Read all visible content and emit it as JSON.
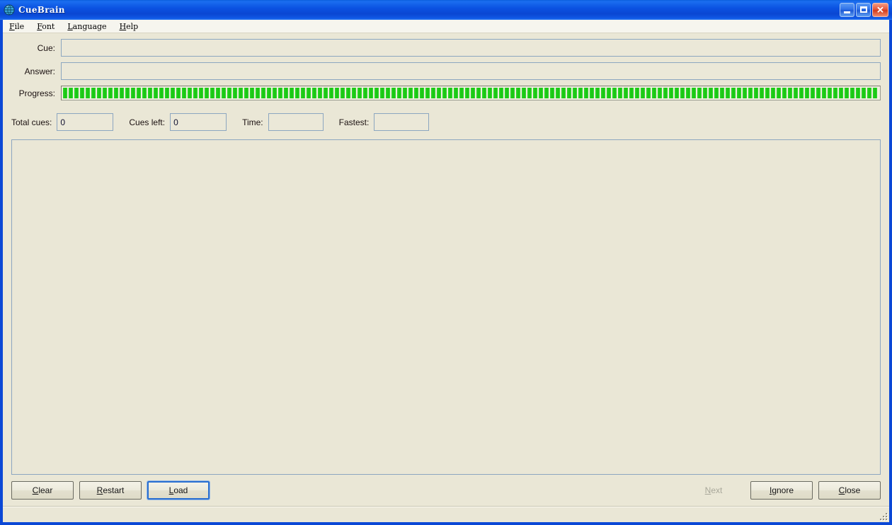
{
  "window": {
    "title": "CueBrain",
    "icon": "globe-icon",
    "controls": {
      "minimize_label": "_",
      "maximize_label": "□",
      "close_label": "✕"
    },
    "accent_color": "#0a46d2",
    "client_color": "#eae7d6"
  },
  "menubar": {
    "items": [
      {
        "label": "File",
        "mnemonic": "F",
        "rest": "ile"
      },
      {
        "label": "Font",
        "mnemonic": "F",
        "rest": "ont"
      },
      {
        "label": "Language",
        "mnemonic": "L",
        "rest": "anguage"
      },
      {
        "label": "Help",
        "mnemonic": "H",
        "rest": "elp"
      }
    ]
  },
  "form": {
    "cue": {
      "label": "Cue:",
      "value": "",
      "placeholder": ""
    },
    "answer": {
      "label": "Answer:",
      "value": "",
      "placeholder": ""
    },
    "progress": {
      "label": "Progress:",
      "percent": 100,
      "chunk_count": 154,
      "fill_color": "#1ecb16",
      "track_color": "#efeede"
    }
  },
  "stats": {
    "total_cues": {
      "label": "Total cues:",
      "value": "0"
    },
    "cues_left": {
      "label": "Cues left:",
      "value": "0"
    },
    "time": {
      "label": "Time:",
      "value": ""
    },
    "fastest": {
      "label": "Fastest:",
      "value": ""
    }
  },
  "content": {
    "text": ""
  },
  "buttons": {
    "left": [
      {
        "name": "clear",
        "mnemonic": "C",
        "before": "",
        "rest": "lear",
        "label": "Clear",
        "disabled": false,
        "focused": false
      },
      {
        "name": "restart",
        "mnemonic": "R",
        "before": "",
        "rest": "estart",
        "label": "Restart",
        "disabled": false,
        "focused": false
      },
      {
        "name": "load",
        "mnemonic": "L",
        "before": "",
        "rest": "oad",
        "label": "Load",
        "disabled": false,
        "focused": true
      }
    ],
    "right": [
      {
        "name": "next",
        "mnemonic": "N",
        "before": "",
        "rest": "ext",
        "label": "Next",
        "disabled": true,
        "focused": false
      },
      {
        "name": "ignore",
        "mnemonic": "I",
        "before": "",
        "rest": "gnore",
        "label": "Ignore",
        "disabled": false,
        "focused": false
      },
      {
        "name": "close",
        "mnemonic": "C",
        "before": "",
        "rest": "lose",
        "label": "Close",
        "disabled": false,
        "focused": false
      }
    ]
  },
  "statusbar": {
    "text": "",
    "resize_grip": "resize-grip-icon"
  }
}
